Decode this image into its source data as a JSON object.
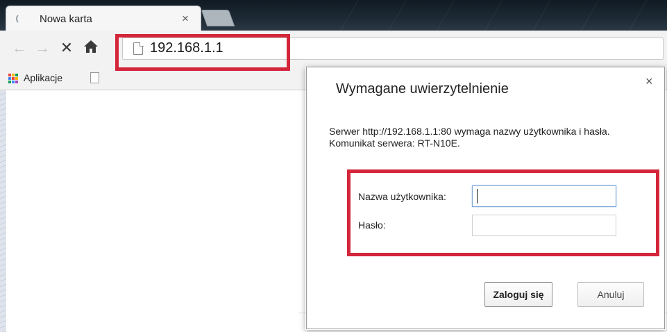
{
  "browser": {
    "tab_title": "Nowa karta",
    "tab_close": "×",
    "url": "192.168.1.1",
    "bookmarks": {
      "apps_label": "Aplikacje"
    },
    "icons": [
      "back-icon",
      "forward-icon",
      "stop-icon",
      "home-icon",
      "page-icon",
      "apps-icon"
    ]
  },
  "dialog": {
    "title": "Wymagane uwierzytelnienie",
    "close": "×",
    "message": "Serwer http://192.168.1.1:80 wymaga nazwy użytkownika i hasła. Komunikat serwera: RT-N10E.",
    "username_label": "Nazwa użytkownika:",
    "username_value": "",
    "password_label": "Hasło:",
    "password_value": "",
    "login_button": "Zaloguj się",
    "cancel_button": "Anuluj"
  },
  "colors": {
    "highlight": "#d4263a",
    "titlebar": "#1d2a35",
    "toolbar": "#f2f2f2",
    "apps_grid": [
      "#e8453c",
      "#f4b400",
      "#0f9d58",
      "#4285f4",
      "#e8453c",
      "#f4b400",
      "#0f9d58",
      "#4285f4",
      "#ab47bc"
    ]
  }
}
